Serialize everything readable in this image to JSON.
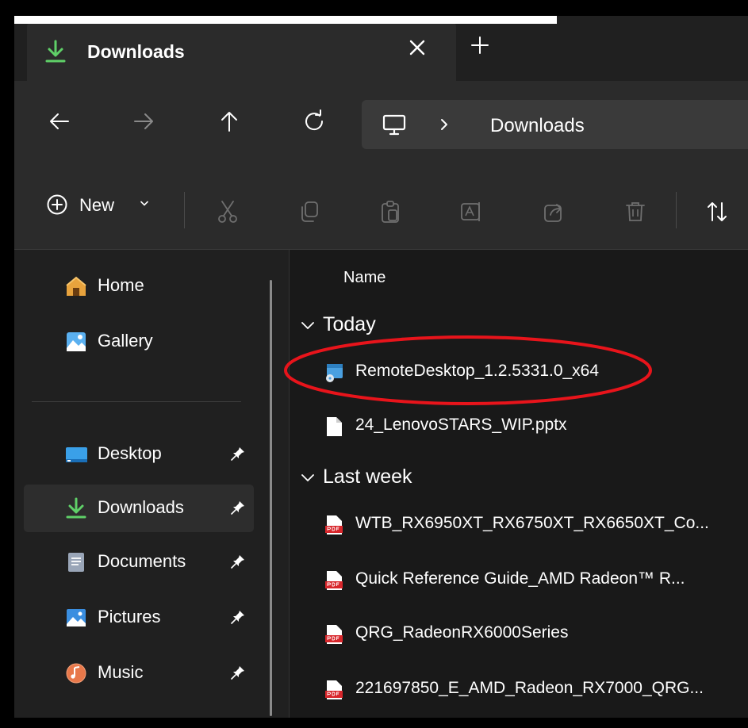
{
  "tab": {
    "title": "Downloads"
  },
  "address": {
    "crumb": "Downloads"
  },
  "toolbar": {
    "new_label": "New"
  },
  "sidebar": {
    "items": [
      {
        "label": "Home",
        "icon": "home-icon"
      },
      {
        "label": "Gallery",
        "icon": "gallery-icon"
      },
      {
        "label": "Desktop",
        "icon": "desktop-folder-icon",
        "pinned": true
      },
      {
        "label": "Downloads",
        "icon": "downloads-folder-icon",
        "pinned": true,
        "selected": true
      },
      {
        "label": "Documents",
        "icon": "documents-folder-icon",
        "pinned": true
      },
      {
        "label": "Pictures",
        "icon": "pictures-folder-icon",
        "pinned": true
      },
      {
        "label": "Music",
        "icon": "music-folder-icon",
        "pinned": true
      }
    ]
  },
  "filelist": {
    "column_name": "Name",
    "groups": [
      {
        "label": "Today",
        "files": [
          {
            "name": "RemoteDesktop_1.2.5331.0_x64",
            "icon": "installer-icon",
            "highlighted": true
          },
          {
            "name": "24_LenovoSTARS_WIP.pptx",
            "icon": "document-icon"
          }
        ]
      },
      {
        "label": "Last week",
        "files": [
          {
            "name": "WTB_RX6950XT_RX6750XT_RX6650XT_Co...",
            "icon": "pdf-icon"
          },
          {
            "name": "Quick Reference Guide_AMD Radeon™ R...",
            "icon": "pdf-icon"
          },
          {
            "name": "QRG_RadeonRX6000Series",
            "icon": "pdf-icon"
          },
          {
            "name": "221697850_E_AMD_Radeon_RX7000_QRG...",
            "icon": "pdf-icon"
          }
        ]
      }
    ]
  },
  "colors": {
    "highlight_ellipse": "#e8141b",
    "accent_green": "#5fd068",
    "selected_bg": "#2d2d2d"
  }
}
